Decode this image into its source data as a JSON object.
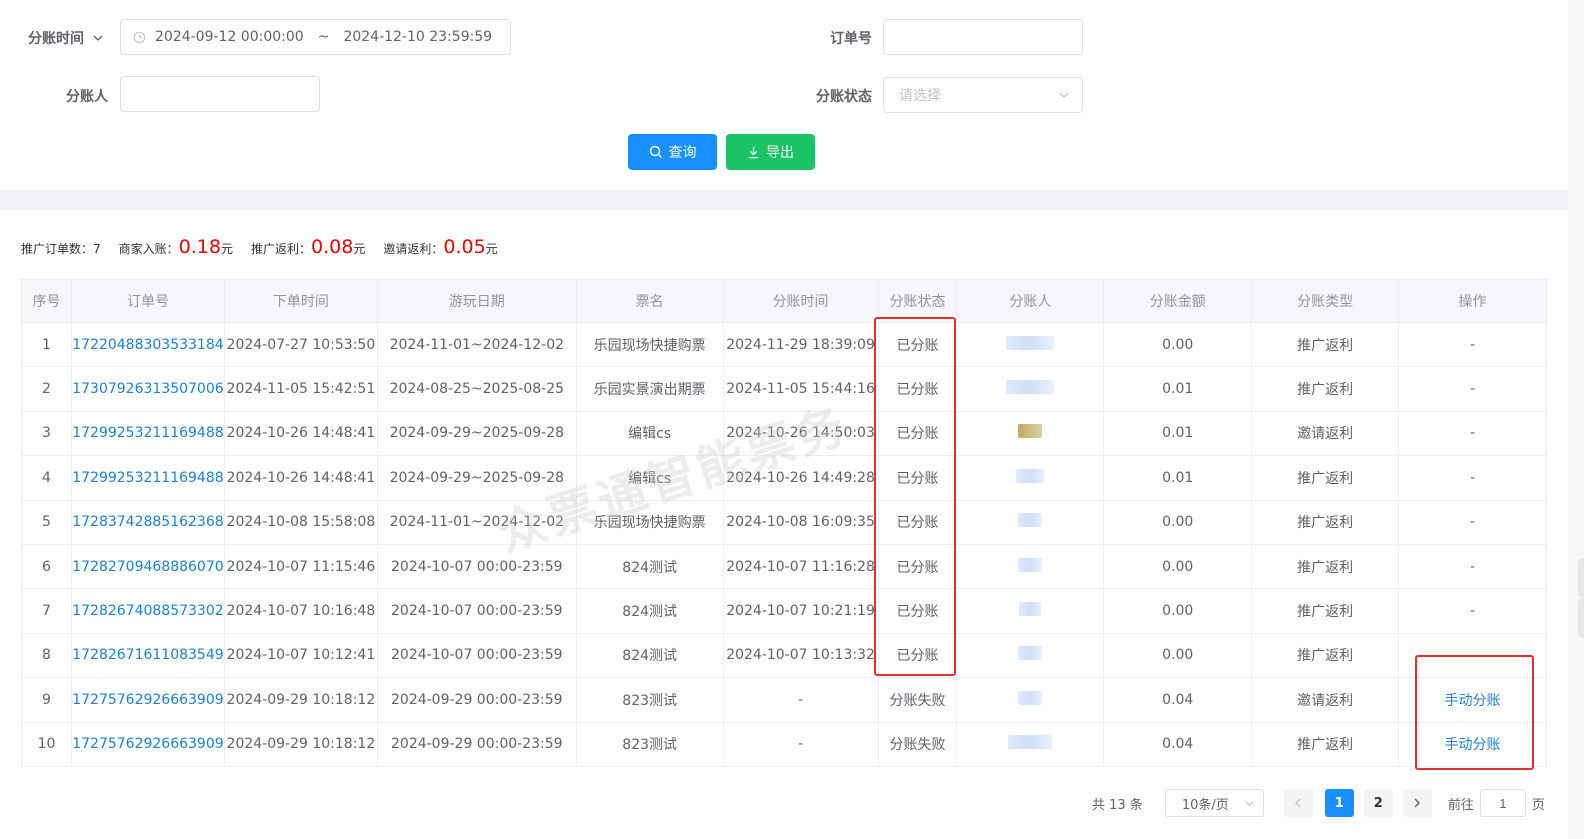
{
  "filters": {
    "split_time_label": "分账时间",
    "date_start": "2024-09-12 00:00:00",
    "date_sep": "~",
    "date_end": "2024-12-10 23:59:59",
    "order_no_label": "订单号",
    "order_no_value": "",
    "splitter_label": "分账人",
    "splitter_value": "",
    "status_label": "分账状态",
    "status_placeholder": "请选择"
  },
  "buttons": {
    "search_label": "查询",
    "export_label": "导出",
    "search_color": "#1890ff",
    "export_color": "#1ac365"
  },
  "stats": {
    "orders_label": "推广订单数：",
    "orders_value": "7",
    "merchant_label": "商家入账：",
    "merchant_value": "0.18",
    "rebate_label": "推广返利：",
    "rebate_value": "0.08",
    "invite_label": "邀请返利：",
    "invite_value": "0.05",
    "currency": "元"
  },
  "table": {
    "headers": [
      "序号",
      "订单号",
      "下单时间",
      "游玩日期",
      "票名",
      "分账时间",
      "分账状态",
      "分账人",
      "分账金额",
      "分账类型",
      "操作"
    ],
    "rows": [
      {
        "no": "1",
        "order": "17220488303533184",
        "order_time": "2024-07-27 10:53:50",
        "play_date": "2024-11-01~2024-12-02",
        "ticket": "乐园现场快捷购票",
        "split_time": "2024-11-29 18:39:09",
        "status": "已分账",
        "amount": "0.00",
        "type": "推广返利",
        "action": "-"
      },
      {
        "no": "2",
        "order": "17307926313507006",
        "order_time": "2024-11-05 15:42:51",
        "play_date": "2024-08-25~2025-08-25",
        "ticket": "乐园实景演出期票",
        "split_time": "2024-11-05 15:44:16",
        "status": "已分账",
        "amount": "0.01",
        "type": "推广返利",
        "action": "-"
      },
      {
        "no": "3",
        "order": "17299253211169488",
        "order_time": "2024-10-26 14:48:41",
        "play_date": "2024-09-29~2025-09-28",
        "ticket": "编辑cs",
        "split_time": "2024-10-26 14:50:03",
        "status": "已分账",
        "amount": "0.01",
        "type": "邀请返利",
        "action": "-"
      },
      {
        "no": "4",
        "order": "17299253211169488",
        "order_time": "2024-10-26 14:48:41",
        "play_date": "2024-09-29~2025-09-28",
        "ticket": "编辑cs",
        "split_time": "2024-10-26 14:49:28",
        "status": "已分账",
        "amount": "0.01",
        "type": "推广返利",
        "action": "-"
      },
      {
        "no": "5",
        "order": "17283742885162368",
        "order_time": "2024-10-08 15:58:08",
        "play_date": "2024-11-01~2024-12-02",
        "ticket": "乐园现场快捷购票",
        "split_time": "2024-10-08 16:09:35",
        "status": "已分账",
        "amount": "0.00",
        "type": "推广返利",
        "action": "-"
      },
      {
        "no": "6",
        "order": "17282709468886070",
        "order_time": "2024-10-07 11:15:46",
        "play_date": "2024-10-07 00:00-23:59",
        "ticket": "824测试",
        "split_time": "2024-10-07 11:16:28",
        "status": "已分账",
        "amount": "0.00",
        "type": "推广返利",
        "action": "-"
      },
      {
        "no": "7",
        "order": "17282674088573302",
        "order_time": "2024-10-07 10:16:48",
        "play_date": "2024-10-07 00:00-23:59",
        "ticket": "824测试",
        "split_time": "2024-10-07 10:21:19",
        "status": "已分账",
        "amount": "0.00",
        "type": "推广返利",
        "action": "-"
      },
      {
        "no": "8",
        "order": "17282671611083549",
        "order_time": "2024-10-07 10:12:41",
        "play_date": "2024-10-07 00:00-23:59",
        "ticket": "824测试",
        "split_time": "2024-10-07 10:13:32",
        "status": "已分账",
        "amount": "0.00",
        "type": "推广返利",
        "action": ""
      },
      {
        "no": "9",
        "order": "17275762926663909",
        "order_time": "2024-09-29 10:18:12",
        "play_date": "2024-09-29 00:00-23:59",
        "ticket": "823测试",
        "split_time": "-",
        "status": "分账失败",
        "amount": "0.04",
        "type": "邀请返利",
        "action": "手动分账"
      },
      {
        "no": "10",
        "order": "17275762926663909",
        "order_time": "2024-09-29 10:18:12",
        "play_date": "2024-09-29 00:00-23:59",
        "ticket": "823测试",
        "split_time": "-",
        "status": "分账失败",
        "amount": "0.04",
        "type": "推广返利",
        "action": "手动分账"
      }
    ]
  },
  "watermark": "众票通智能票务",
  "pagination": {
    "total_text": "共 13 条",
    "page_size": "10条/页",
    "pages": [
      "1",
      "2"
    ],
    "current_page": "1",
    "goto_label": "前往",
    "goto_value": "1",
    "page_unit": "页",
    "active_color": "#1890ff"
  },
  "highlight_color": "#e23030"
}
